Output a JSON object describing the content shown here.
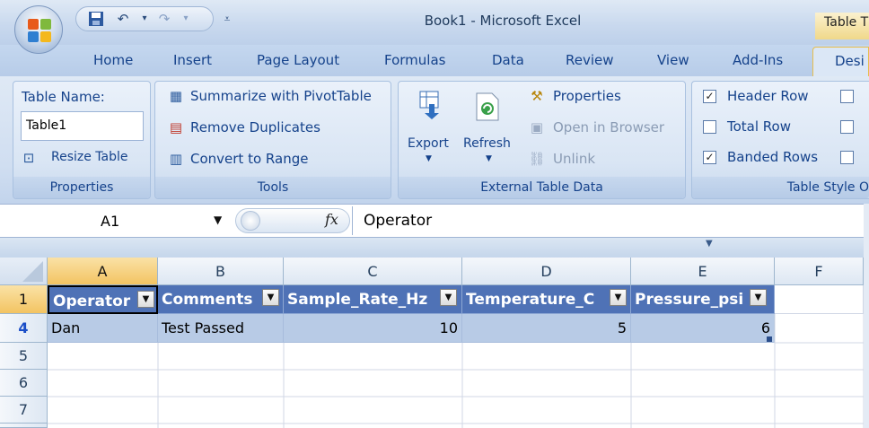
{
  "window": {
    "title": "Book1 - Microsoft Excel",
    "context_tab": "Table T"
  },
  "qat": {
    "save_icon": "save-icon",
    "undo_icon": "undo-icon",
    "redo_icon": "redo-icon",
    "customize_icon": "customize-qat-icon"
  },
  "tabs": [
    "Home",
    "Insert",
    "Page Layout",
    "Formulas",
    "Data",
    "Review",
    "View",
    "Add-Ins"
  ],
  "active_tab": "Desi",
  "ribbon": {
    "properties": {
      "table_name_label": "Table Name:",
      "table_name_value": "Table1",
      "resize_label": "Resize Table",
      "group_label": "Properties"
    },
    "tools": {
      "pivot_label": "Summarize with PivotTable",
      "remove_dup_label": "Remove Duplicates",
      "convert_label": "Convert to Range",
      "group_label": "Tools"
    },
    "external": {
      "export_label": "Export",
      "refresh_label": "Refresh",
      "properties_label": "Properties",
      "open_browser_label": "Open in Browser",
      "unlink_label": "Unlink",
      "group_label": "External Table Data"
    },
    "style_options": {
      "header_row_label": "Header Row",
      "header_row_checked": true,
      "total_row_label": "Total Row",
      "total_row_checked": false,
      "banded_rows_label": "Banded Rows",
      "banded_rows_checked": true,
      "group_label": "Table Style O"
    }
  },
  "formula_bar": {
    "name_box": "A1",
    "fx": "fx",
    "formula": "Operator"
  },
  "grid": {
    "columns": [
      "A",
      "B",
      "C",
      "D",
      "E",
      "F"
    ],
    "rows": [
      "1",
      "4",
      "5",
      "6",
      "7"
    ],
    "header": [
      "Operator",
      "Comments",
      "Sample_Rate_Hz",
      "Temperature_C",
      "Pressure_psi"
    ],
    "data_row": [
      "Dan",
      "Test Passed",
      "10",
      "5",
      "6"
    ]
  },
  "colors": {
    "accent": "#4f72b6",
    "band": "#b8cbe6",
    "selected_header": "#f3c462"
  }
}
